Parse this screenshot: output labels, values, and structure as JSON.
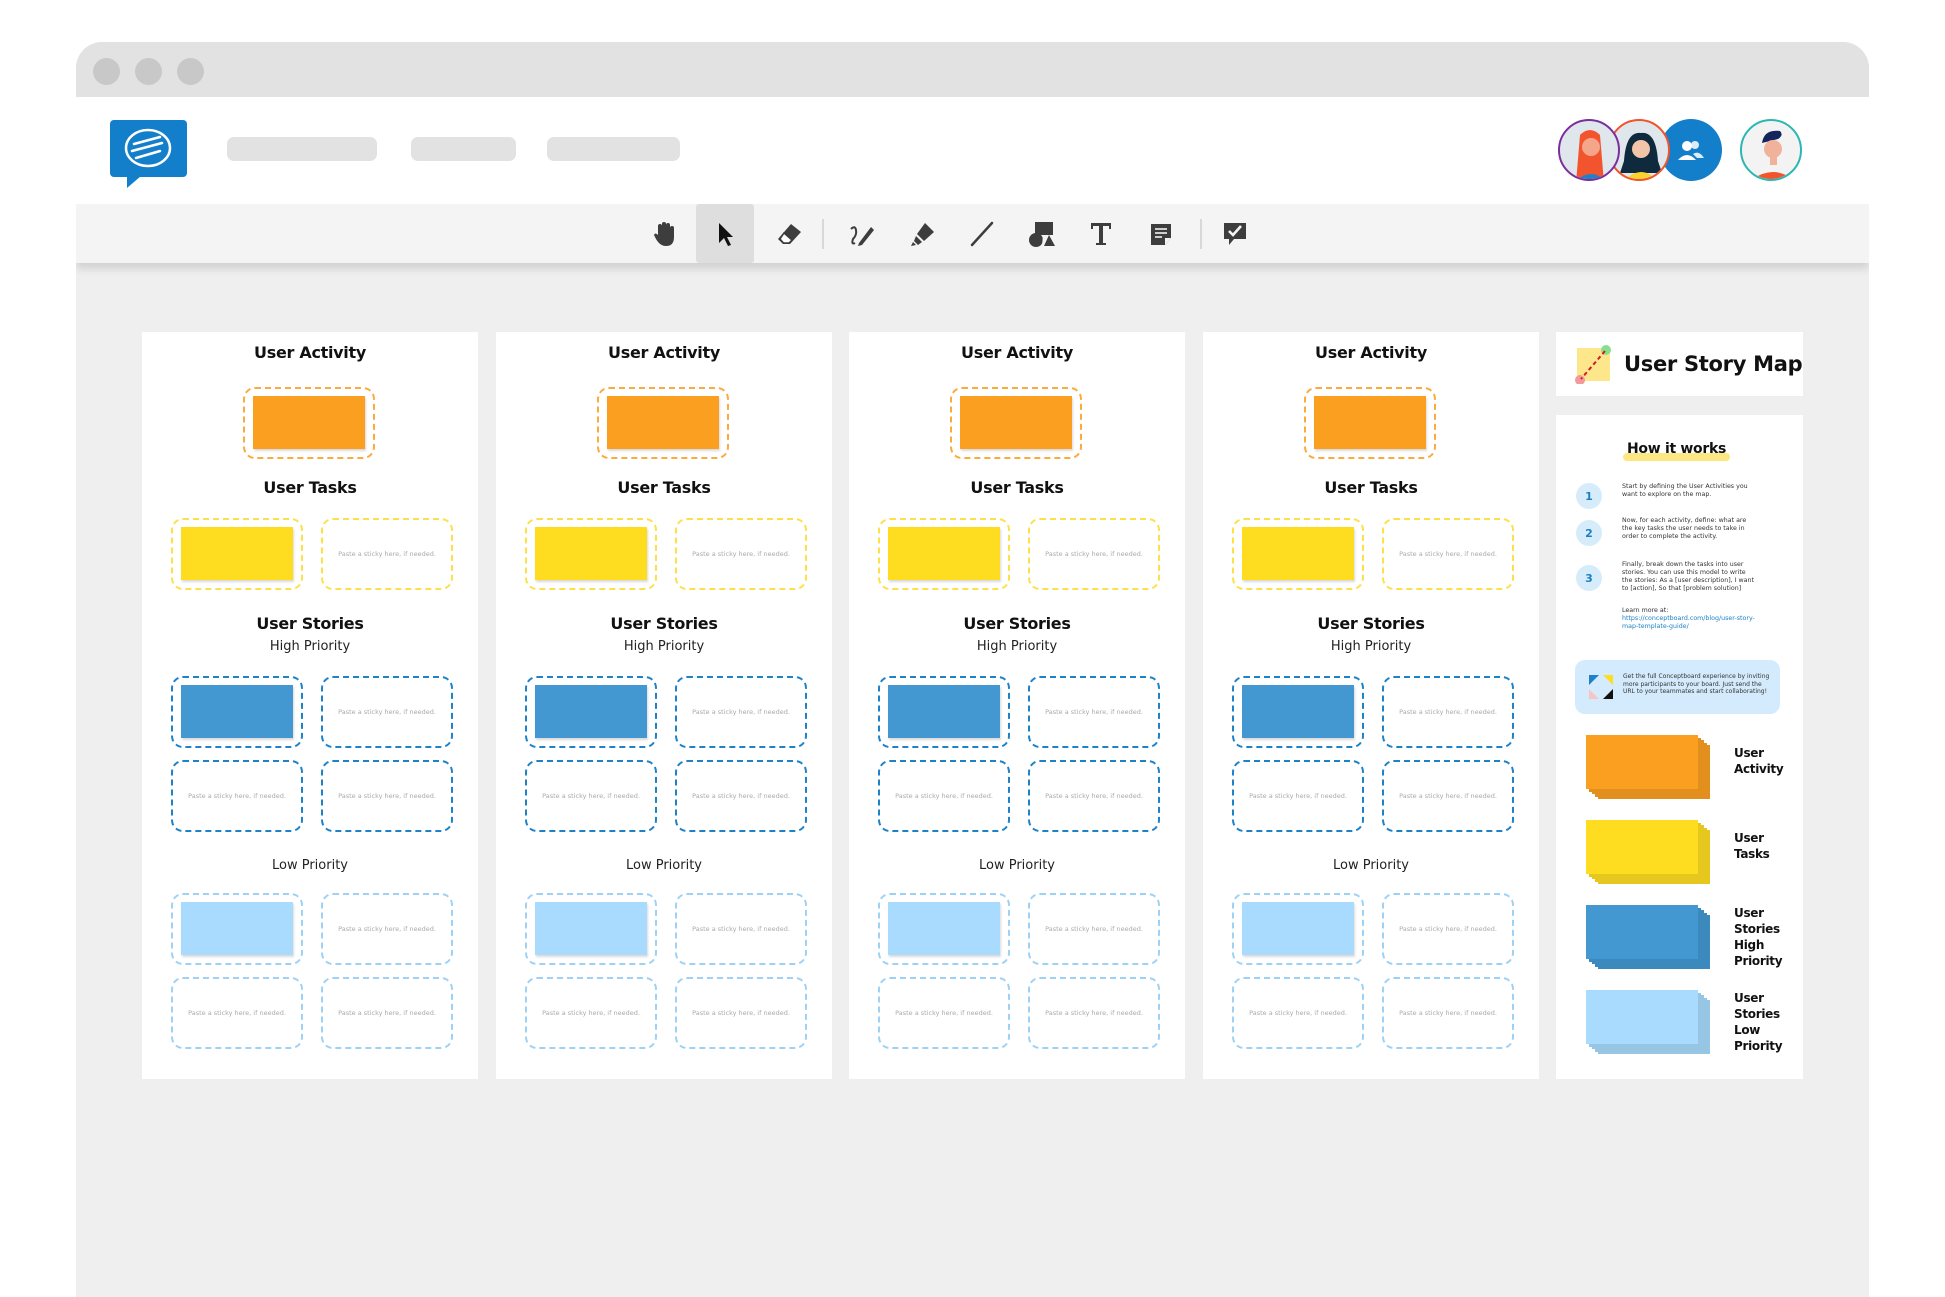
{
  "window": {
    "traffic_lights": [
      "close",
      "minimize",
      "maximize"
    ]
  },
  "header": {
    "logo": "conceptboard-logo-icon",
    "nav_placeholders": 3,
    "avatars": [
      {
        "name": "avatar-woman-red-hair",
        "ring": "#7b2f9c"
      },
      {
        "name": "avatar-woman-dark-hair",
        "ring": "#f0542a"
      },
      {
        "name": "participants-button",
        "ring": "#137fcb"
      },
      {
        "name": "avatar-man-current-user",
        "ring": "#2ab7b2"
      }
    ]
  },
  "toolbar": {
    "tools": [
      {
        "id": "hand",
        "icon": "hand-icon",
        "active": false
      },
      {
        "id": "select",
        "icon": "cursor-arrow-icon",
        "active": true
      },
      {
        "id": "eraser",
        "icon": "eraser-icon",
        "active": false
      },
      {
        "id": "draw",
        "icon": "pen-draw-icon",
        "active": false
      },
      {
        "id": "highlighter",
        "icon": "highlighter-icon",
        "active": false
      },
      {
        "id": "line",
        "icon": "line-icon",
        "active": false
      },
      {
        "id": "shapes",
        "icon": "shapes-icon",
        "active": false
      },
      {
        "id": "text",
        "icon": "text-icon",
        "active": false
      },
      {
        "id": "sticky-note",
        "icon": "sticky-note-icon",
        "active": false
      },
      {
        "id": "review",
        "icon": "review-check-icon",
        "active": false
      }
    ]
  },
  "colors": {
    "activity": "#fb9f20",
    "activity_border": "#fca93d",
    "tasks": "#fedd21",
    "tasks_border": "#fde04a",
    "stories_high": "#4398d2",
    "stories_high_border": "#1d82c8",
    "stories_low": "#a8dbfd",
    "stories_low_border": "#9ed2f5",
    "brand": "#137fcb"
  },
  "columns": [
    {
      "activity_title": "User Activity",
      "tasks_title": "User Tasks",
      "stories_title": "User Stories",
      "high_priority": "High Priority",
      "low_priority": "Low Priority",
      "placeholder": "Paste a sticky here, if needed."
    },
    {
      "activity_title": "User Activity",
      "tasks_title": "User Tasks",
      "stories_title": "User Stories",
      "high_priority": "High Priority",
      "low_priority": "Low Priority",
      "placeholder": "Paste a sticky here, if needed."
    },
    {
      "activity_title": "User Activity",
      "tasks_title": "User Tasks",
      "stories_title": "User Stories",
      "high_priority": "High Priority",
      "low_priority": "Low Priority",
      "placeholder": "Paste a sticky here, if needed."
    },
    {
      "activity_title": "User Activity",
      "tasks_title": "User Tasks",
      "stories_title": "User Stories",
      "high_priority": "High Priority",
      "low_priority": "Low Priority",
      "placeholder": "Paste a sticky here, if needed."
    }
  ],
  "panel": {
    "title": "User Story Map",
    "how_it_works": "How it works",
    "steps": [
      {
        "num": "1",
        "text": "Start by defining the User Activities you want to explore on the map."
      },
      {
        "num": "2",
        "text": "Now, for each activity, define: what are the key tasks the user needs to take in order to complete the activity."
      },
      {
        "num": "3",
        "text": "Finally, break down the tasks into user stories. You can use this model to write the stories: As a [user description], I want to [action], So that [problem solution]"
      }
    ],
    "learn_more_label": "Learn more at:",
    "learn_more_link": "https://conceptboard.com/blog/user-story-map-template-guide/",
    "invite_text": "Get the full Conceptboard experience by inviting more participants to your board. Just send the URL to your teammates and start collaborating!",
    "legend": [
      {
        "label": "User Activity",
        "color_key": "activity"
      },
      {
        "label": "User Tasks",
        "color_key": "tasks"
      },
      {
        "label": "User Stories High Priority",
        "color_key": "stories_high"
      },
      {
        "label": "User Stories Low Priority",
        "color_key": "stories_low"
      }
    ]
  }
}
